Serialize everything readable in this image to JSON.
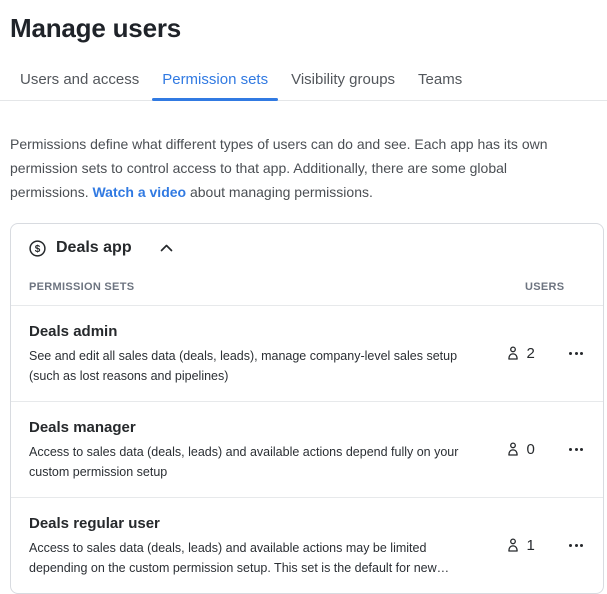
{
  "page": {
    "title": "Manage users"
  },
  "tabs": [
    {
      "label": "Users and access",
      "active": false
    },
    {
      "label": "Permission sets",
      "active": true
    },
    {
      "label": "Visibility groups",
      "active": false
    },
    {
      "label": "Teams",
      "active": false
    }
  ],
  "intro": {
    "text_before": "Permissions define what different types of users can do and see. Each app has its own\npermission sets to control access to that app. Additionally, there are some global\npermissions. ",
    "link_label": "Watch a video",
    "text_after": " about managing permissions."
  },
  "card": {
    "app_name": "Deals app",
    "columns": {
      "permission_sets": "PERMISSION SETS",
      "users": "USERS"
    },
    "rows": [
      {
        "name": "Deals admin",
        "description": "See and edit all sales data (deals, leads), manage company-level sales setup\n(such as lost reasons and pipelines)",
        "users": "2"
      },
      {
        "name": "Deals manager",
        "description": "Access to sales data (deals, leads) and available actions depend fully on your\ncustom permission setup",
        "users": "0"
      },
      {
        "name": "Deals regular user",
        "description": "Access to sales data (deals, leads) and available actions may be limited\ndepending on the custom permission setup. This set is the default for new…",
        "users": "1"
      }
    ]
  },
  "icons": {
    "app_icon": "dollar-circle",
    "collapse_icon": "chevron-up",
    "users_icon": "person",
    "menu_icon": "ellipsis-horizontal"
  },
  "colors": {
    "accent_blue": "#317ae2",
    "text_dark": "#26292c",
    "text_gray": "#4b4f54",
    "column_header_gray": "#6d7480",
    "card_border": "#d8dbe0",
    "divider": "#e4e6e8"
  }
}
